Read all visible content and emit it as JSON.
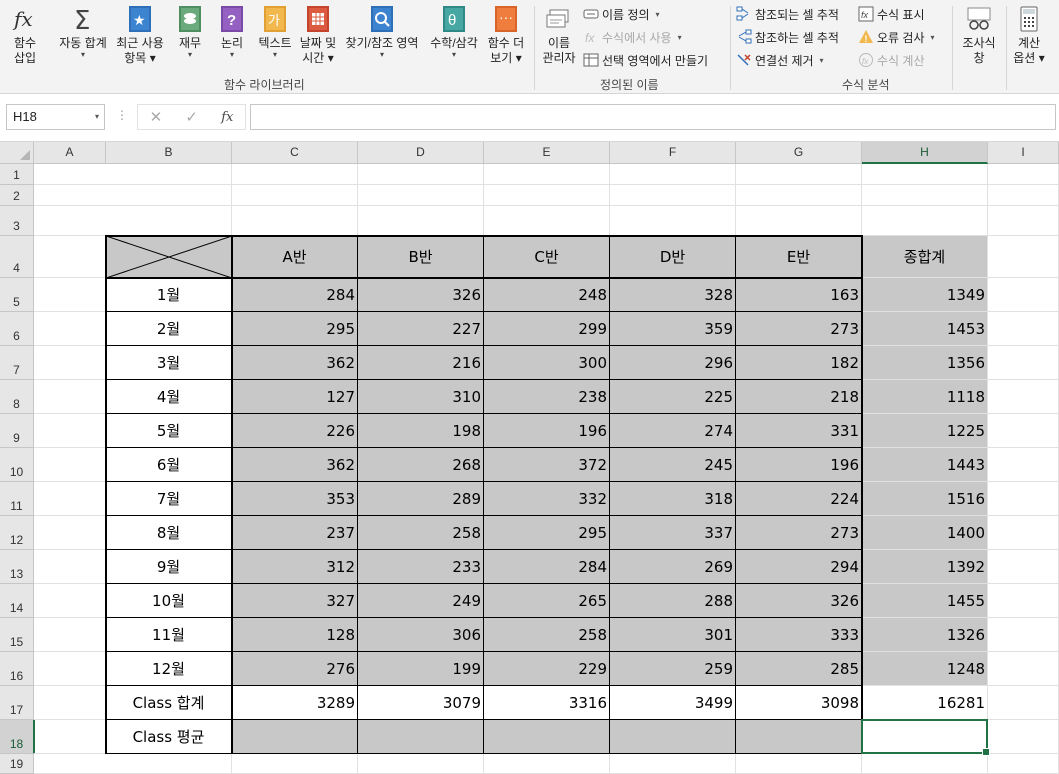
{
  "ribbon": {
    "buttons": [
      {
        "id": "insert-function",
        "label1": "함수",
        "label2": "삽입",
        "icon": "fx-icon"
      },
      {
        "id": "autosum",
        "label1": "자동 합계",
        "caret": true,
        "icon": "sigma-icon"
      },
      {
        "id": "recent",
        "label1": "최근 사용",
        "label2": "항목",
        "caret": true,
        "icon": "star-book-icon"
      },
      {
        "id": "financial",
        "label1": "재무",
        "caret": true,
        "icon": "coins-book-icon"
      },
      {
        "id": "logical",
        "label1": "논리",
        "caret": true,
        "icon": "question-book-icon"
      },
      {
        "id": "text",
        "label1": "텍스트",
        "caret": true,
        "icon": "text-book-icon"
      },
      {
        "id": "datetime",
        "label1": "날짜 및",
        "label2": "시간",
        "caret": true,
        "icon": "calendar-book-icon"
      },
      {
        "id": "lookup",
        "label1": "찾기/참조 영역",
        "caret": true,
        "icon": "magnifier-book-icon"
      },
      {
        "id": "math",
        "label1": "수학/삼각",
        "caret": true,
        "icon": "theta-book-icon"
      },
      {
        "id": "more",
        "label1": "함수 더",
        "label2": "보기",
        "caret": true,
        "icon": "more-book-icon"
      },
      {
        "id": "name-manager",
        "label1": "이름",
        "label2": "관리자",
        "icon": "name-manager-icon"
      },
      {
        "id": "watch",
        "label1": "조사식",
        "label2": "창",
        "icon": "glasses-icon"
      },
      {
        "id": "calc-options",
        "label1": "계산",
        "label2": "옵션",
        "caret": true,
        "icon": "calculator-icon"
      }
    ],
    "defined_names": [
      {
        "label": "이름 정의",
        "caret": true,
        "enabled": true
      },
      {
        "label": "수식에서 사용",
        "caret": true,
        "enabled": false
      },
      {
        "label": "선택 영역에서 만들기",
        "enabled": true
      }
    ],
    "auditing_left": [
      {
        "label": "참조되는 셀 추적",
        "enabled": true
      },
      {
        "label": "참조하는 셀 추적",
        "enabled": true
      },
      {
        "label": "연결선 제거",
        "caret": true,
        "enabled": true
      }
    ],
    "auditing_right": [
      {
        "label": "수식 표시",
        "enabled": true
      },
      {
        "label": "오류 검사",
        "caret": true,
        "enabled": true
      },
      {
        "label": "수식 계산",
        "enabled": false
      }
    ],
    "groups": {
      "library": "함수 라이브러리",
      "defined": "정의된 이름",
      "auditing": "수식 분석"
    }
  },
  "formula_bar": {
    "name_box": "H18",
    "fx": "fx",
    "value": ""
  },
  "sheet": {
    "columns": [
      "A",
      "B",
      "C",
      "D",
      "E",
      "F",
      "G",
      "H",
      "I"
    ],
    "selected_column": "H",
    "rows": [
      "1",
      "2",
      "3",
      "4",
      "5",
      "6",
      "7",
      "8",
      "9",
      "10",
      "11",
      "12",
      "13",
      "14",
      "15",
      "16",
      "17",
      "18",
      "19"
    ],
    "selected_row": "18",
    "table": {
      "header": [
        "A반",
        "B반",
        "C반",
        "D반",
        "E반",
        "종합계"
      ],
      "months": [
        "1월",
        "2월",
        "3월",
        "4월",
        "5월",
        "6월",
        "7월",
        "8월",
        "9월",
        "10월",
        "11월",
        "12월"
      ],
      "values": [
        [
          284,
          326,
          248,
          328,
          163,
          1349
        ],
        [
          295,
          227,
          299,
          359,
          273,
          1453
        ],
        [
          362,
          216,
          300,
          296,
          182,
          1356
        ],
        [
          127,
          310,
          238,
          225,
          218,
          1118
        ],
        [
          226,
          198,
          196,
          274,
          331,
          1225
        ],
        [
          362,
          268,
          372,
          245,
          196,
          1443
        ],
        [
          353,
          289,
          332,
          318,
          224,
          1516
        ],
        [
          237,
          258,
          295,
          337,
          273,
          1400
        ],
        [
          312,
          233,
          284,
          269,
          294,
          1392
        ],
        [
          327,
          249,
          265,
          288,
          326,
          1455
        ],
        [
          128,
          306,
          258,
          301,
          333,
          1326
        ],
        [
          276,
          199,
          229,
          259,
          285,
          1248
        ]
      ],
      "total_label": "Class 합계",
      "totals": [
        3289,
        3079,
        3316,
        3499,
        3098,
        16281
      ],
      "average_label": "Class 평균",
      "averages": [
        "",
        "",
        "",
        "",
        "",
        ""
      ]
    },
    "colors": {
      "data_fill": "#c8c8c8",
      "selection": "#217346"
    }
  }
}
